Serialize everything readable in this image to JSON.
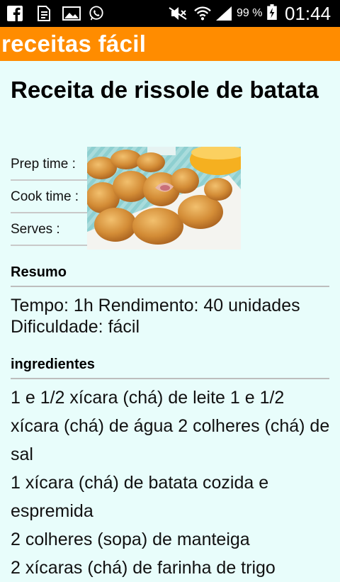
{
  "status_bar": {
    "battery_percent": "99 %",
    "time": "01:44",
    "icons": [
      "facebook-icon",
      "file-icon",
      "image-icon",
      "whatsapp-icon",
      "mute-icon",
      "wifi-icon",
      "signal-icon",
      "battery-charging-icon"
    ]
  },
  "app_bar": {
    "title": "receitas fácil",
    "color": "#ff8c00"
  },
  "recipe": {
    "title": "Receita de rissole de batata",
    "meta": {
      "prep_label": "Prep time :",
      "cook_label": "Cook time :",
      "serves_label": "Serves :"
    },
    "resumo": {
      "heading": "Resumo",
      "line1": "Tempo: 1h Rendimento: 40 unidades",
      "line2": "Dificuldade: fácil"
    },
    "ingredientes": {
      "heading": "ingredientes",
      "items": [
        "1 e 1/2 xícara (chá) de leite 1 e 1/2 xícara (chá) de água 2 colheres (chá) de sal",
        "1 xícara (chá) de batata cozida e espremida",
        "2 colheres (sopa) de manteiga",
        "2 xícaras (chá) de farinha de trigo"
      ]
    }
  },
  "colors": {
    "background": "#e8fdfb",
    "accent": "#ff8c00"
  }
}
